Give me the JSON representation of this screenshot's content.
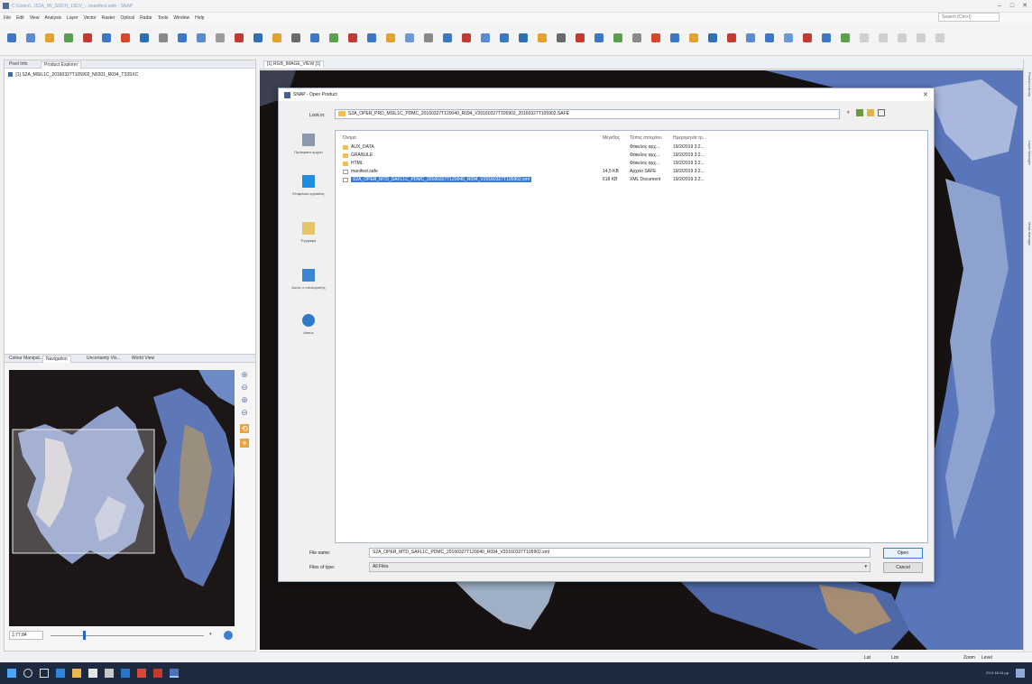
{
  "window": {
    "title": "C:\\Users\\...\\S1A_IW_GRDH_1SDV_...\\manifest.safe - SNAP",
    "menu": [
      "File",
      "Edit",
      "View",
      "Analysis",
      "Layer",
      "Vector",
      "Raster",
      "Optical",
      "Radar",
      "Tools",
      "Window",
      "Help"
    ],
    "search_placeholder": "Search (Ctrl+I)",
    "controls": {
      "minimize": "–",
      "maximize": "□",
      "close": "✕"
    }
  },
  "left_top": {
    "tabs": [
      "Pixel Info",
      "Product Explorer"
    ],
    "tree_item": "[1] S2A_MSIL1C_20160327T105902_N0201_R094_T33SXC"
  },
  "left_bottom": {
    "tabs": [
      "Colour Manipul...",
      "Navigation",
      "Uncertainty Vis...",
      "World View"
    ],
    "zoom_label": "1:77.84"
  },
  "main": {
    "doc_tab": "[1] RGB_IMAGE_VIEW [1]",
    "status": {
      "lat": "Lat",
      "lon": "Lon",
      "zoom": "Zoom",
      "level": "Level"
    },
    "right_tabs": [
      "Product Library",
      "Layer Manager",
      "Mask Manager"
    ]
  },
  "dialog": {
    "title": "SNAP - Open Product",
    "look_in_label": "Look in:",
    "look_in_value": "S2A_OPER_PRD_MSIL1C_PDMC_20160327T120040_R094_V20160327T105902_20160327T105902.SAFE",
    "places": [
      "Πρόσφατα αρχεία",
      "Επιφάνεια εργασίας",
      "Έγγραφα",
      "Αυτός ο υπολογιστής",
      "Δίκτυο"
    ],
    "columns": {
      "name": "Όνομα",
      "size": "Μέγεθος",
      "type": "Τύπος στοιχείου",
      "modified": "Ημερομηνία τρ..."
    },
    "files": [
      {
        "name": "AUX_DATA",
        "size": "",
        "type": "Φάκελος αρχ...",
        "modified": "19/2/2019 3:2..."
      },
      {
        "name": "GRANULE",
        "size": "",
        "type": "Φάκελος αρχ...",
        "modified": "19/2/2019 3:2..."
      },
      {
        "name": "HTML",
        "size": "",
        "type": "Φάκελος αρχ...",
        "modified": "19/2/2019 3:2..."
      },
      {
        "name": "manifest.safe",
        "size": "14,5 KB",
        "type": "Αρχείο SAFE",
        "modified": "19/2/2019 3:2..."
      },
      {
        "name": "S2A_OPER_MTD_SAFL1C_PDMC_20160327T120040_R094_V20160327T105902.xml",
        "size": "618 KB",
        "type": "XML Document",
        "modified": "19/2/2019 3:2..."
      }
    ],
    "file_name_label": "File name:",
    "file_name_value": "S2A_OPER_MTD_SAFL1C_PDMC_20160327T120040_R094_V20160327T105902.xml",
    "file_type_label": "Files of type:",
    "file_type_value": "All Files",
    "open_label": "Open",
    "cancel_label": "Cancel"
  },
  "taskbar": {
    "clock": "ΕΛΛ 18:14 μμ"
  },
  "colors": {
    "selection": "#3a7ad2",
    "taskbar": "#1d2a3f",
    "folder": "#f1c14b"
  }
}
